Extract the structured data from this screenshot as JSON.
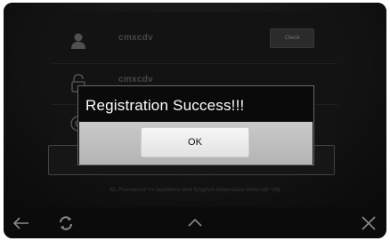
{
  "form": {
    "username": "cmxcdv",
    "password": "cmxcdv",
    "check_label": "Check"
  },
  "hint": "ID, Password >> numbers and English lowercase letters(6~16)",
  "dialog": {
    "title": "Registration Success!!!",
    "ok_label": "OK"
  },
  "navbar": {
    "icons": [
      "back-arrow-icon",
      "refresh-icon",
      "chevron-up-icon",
      "close-icon"
    ]
  },
  "colors": {
    "dialog_background": "#0a0a0a",
    "dialog_footer": "#c0c0c0",
    "screen_background": "#161616"
  }
}
